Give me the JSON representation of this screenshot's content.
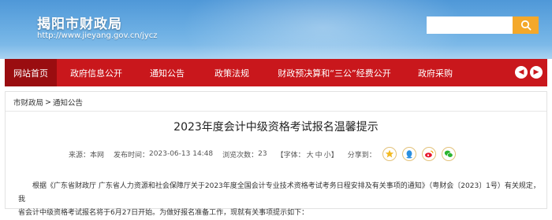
{
  "header": {
    "site_title": "揭阳市财政局",
    "site_url": "http://www.jieyang.gov.cn/jycz",
    "search": {
      "placeholder": "",
      "button_icon": "search-icon"
    },
    "colors": {
      "sky": "#5fa6e0",
      "search_button": "#f4a82a"
    }
  },
  "nav": {
    "items": [
      {
        "label": "网站首页",
        "active": true
      },
      {
        "label": "政府信息公开",
        "active": false
      },
      {
        "label": "通知公告",
        "active": false
      },
      {
        "label": "政策法规",
        "active": false
      },
      {
        "label": "财政预决算和“三公”经费公开",
        "active": false
      },
      {
        "label": "政府采购",
        "active": false
      }
    ],
    "prev_icon": "chevron-left-icon",
    "next_icon": "chevron-right-icon",
    "colors": {
      "bar": "#c9171c",
      "active": "#9a0d10"
    }
  },
  "breadcrumb": {
    "items": [
      "市财政局",
      "通知公告"
    ],
    "separator": ">"
  },
  "article": {
    "title": "2023年度会计中级资格考试报名温馨提示",
    "meta": {
      "source_label": "来源：",
      "source": "本网",
      "date_label": "发布时间：",
      "date": "2023-06-13 14:48",
      "views_label": "浏览次数：",
      "views": "23",
      "font_label": "【字体：",
      "font_large": "大",
      "font_medium": "中",
      "font_small": "小",
      "font_end": "】",
      "share_label": "分享到："
    },
    "share": [
      "qzone-icon",
      "qq-icon",
      "weibo-icon",
      "wechat-icon"
    ],
    "paragraph_line1": "根据《广东省财政厅 广东省人力资源和社会保障厅关于2023年度全国会计专业技术资格考试考务日程安排及有关事项的通知》（粤财会〔2023〕1号）有关规定，我",
    "paragraph_line2": "省会计中级资格考试报名将于6月27日开始。为做好报名准备工作，现就有关事项提示如下："
  }
}
